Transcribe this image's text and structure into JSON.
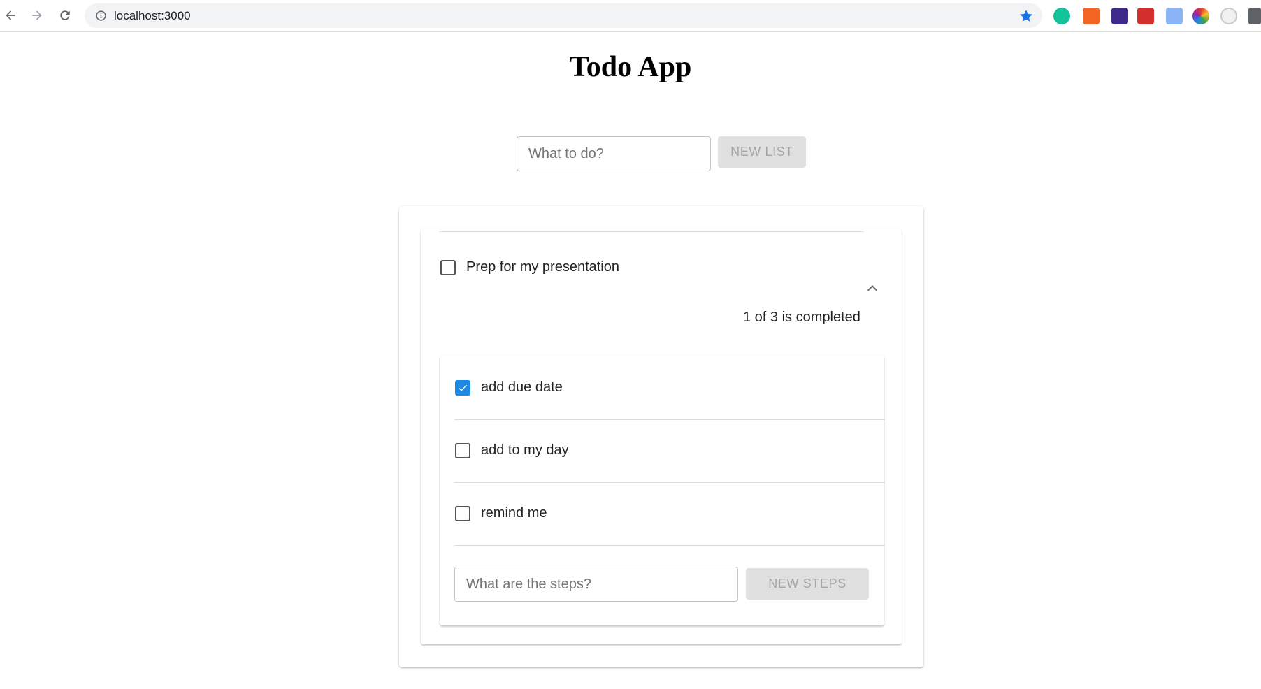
{
  "browser": {
    "url": "localhost:3000"
  },
  "app": {
    "title": "Todo App",
    "list_input_placeholder": "What to do?",
    "new_list_label": "NEW LIST"
  },
  "task": {
    "label": "Prep for my presentation",
    "checked": false,
    "progress_text": "1 of 3 is completed"
  },
  "steps": [
    {
      "label": "add due date",
      "checked": true
    },
    {
      "label": "add to my day",
      "checked": false
    },
    {
      "label": "remind me",
      "checked": false
    }
  ],
  "steps_input_placeholder": "What are the steps?",
  "new_steps_label": "NEW STEPS",
  "colors": {
    "accent": "#1e88e5",
    "star": "#1a73e8",
    "disabled_bg": "#e0e0e0",
    "disabled_text": "#a6a6a6"
  },
  "icons": {
    "back": "arrow-left-icon",
    "forward": "arrow-right-icon",
    "reload": "reload-icon",
    "info": "info-icon",
    "bookmark": "star-icon",
    "expand": "chevron-up-icon"
  }
}
